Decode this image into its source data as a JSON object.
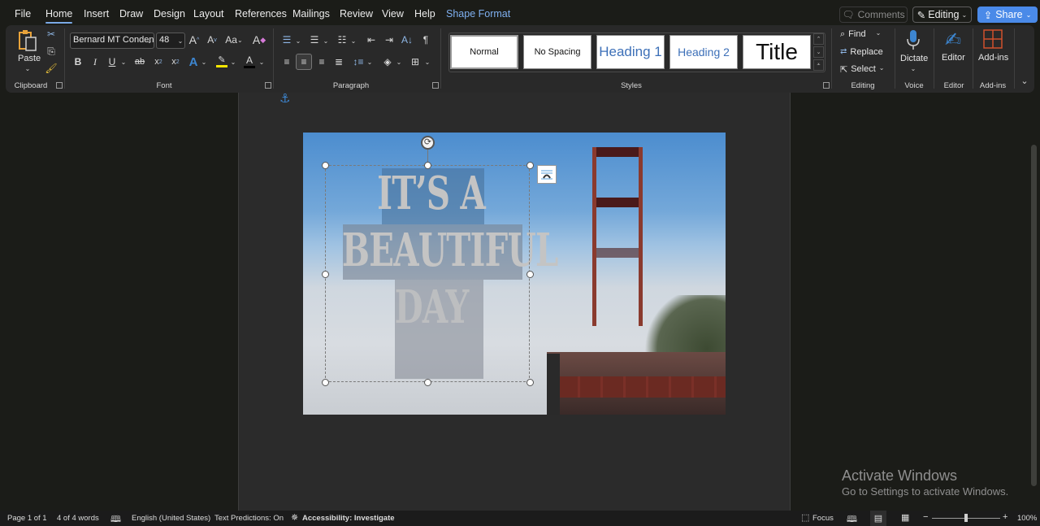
{
  "menu": {
    "tabs": [
      "File",
      "Home",
      "Insert",
      "Draw",
      "Design",
      "Layout",
      "References",
      "Mailings",
      "Review",
      "View",
      "Help",
      "Shape Format"
    ],
    "active_tab": "Home",
    "comments_label": "Comments",
    "editing_label": "Editing",
    "share_label": "Share"
  },
  "ribbon": {
    "clipboard": {
      "paste_label": "Paste",
      "group_label": "Clipboard"
    },
    "font": {
      "font_name": "Bernard MT Conden:",
      "font_size": "48",
      "group_label": "Font",
      "highlight_color": "#f5e600",
      "font_color": "#000000"
    },
    "paragraph": {
      "group_label": "Paragraph"
    },
    "styles": {
      "group_label": "Styles",
      "items": [
        "Normal",
        "No Spacing",
        "Heading 1",
        "Heading 2",
        "Title"
      ]
    },
    "editing": {
      "find_label": "Find",
      "replace_label": "Replace",
      "select_label": "Select",
      "group_label": "Editing"
    },
    "voice": {
      "dictate_label": "Dictate",
      "group_label": "Voice"
    },
    "editor": {
      "editor_label": "Editor",
      "group_label": "Editor"
    },
    "addins": {
      "addins_label": "Add-ins",
      "group_label": "Add-ins"
    }
  },
  "document": {
    "wordart_lines": [
      "IT’S A",
      "BEAUTIFUL",
      "DAY"
    ],
    "image_description": "Golden Gate Bridge in fog"
  },
  "watermark": {
    "title": "Activate Windows",
    "subtitle": "Go to Settings to activate Windows."
  },
  "statusbar": {
    "page": "Page 1 of 1",
    "words": "4 of 4 words",
    "language": "English (United States)",
    "text_predictions": "Text Predictions: On",
    "accessibility": "Accessibility: Investigate",
    "focus_label": "Focus",
    "zoom_level": "100%",
    "zoom_minus": "−",
    "zoom_plus": "+"
  }
}
